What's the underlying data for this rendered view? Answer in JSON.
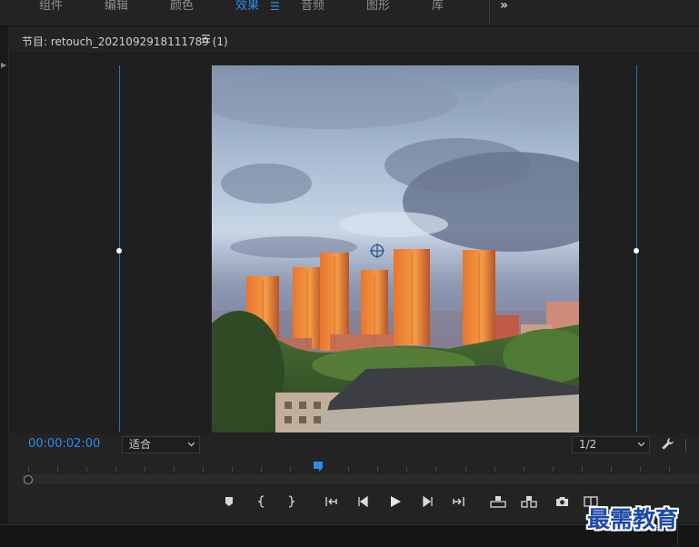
{
  "workspace_tabs": [
    {
      "label": "组件",
      "active": false
    },
    {
      "label": "编辑",
      "active": false
    },
    {
      "label": "颜色",
      "active": false
    },
    {
      "label": "效果",
      "active": true
    },
    {
      "label": "音频",
      "active": false
    },
    {
      "label": "图形",
      "active": false
    },
    {
      "label": "库",
      "active": false
    }
  ],
  "program_monitor": {
    "title": "节目: retouch_2021092918111789 (1)",
    "timecode": "00:00:02:00",
    "zoom_select": "适合",
    "resolution_select": "1/2"
  },
  "transport": {
    "buttons": [
      "add-marker",
      "mark-in",
      "mark-out",
      "go-to-in",
      "step-back",
      "play",
      "step-forward",
      "go-to-out",
      "lift",
      "extract",
      "export-frame",
      "comparison-view"
    ]
  },
  "watermark": "最需教育",
  "colors": {
    "accent": "#2d8ceb",
    "guide": "#2d6fbf",
    "watermark": "#1d4aa8"
  }
}
